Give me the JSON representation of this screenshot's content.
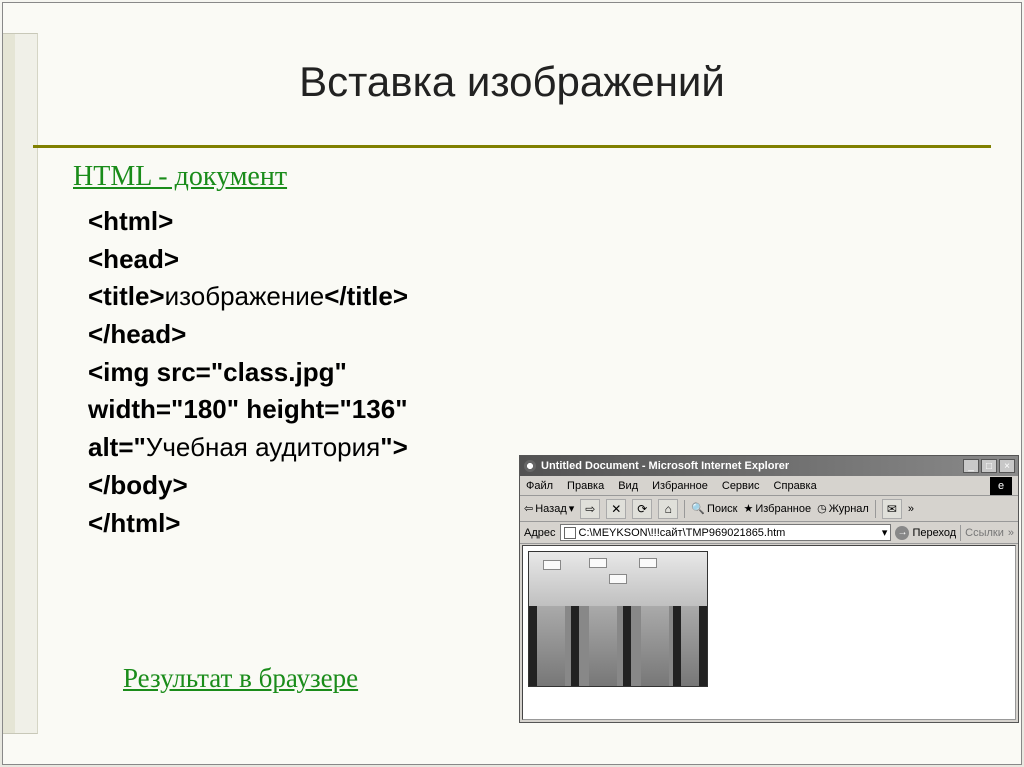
{
  "slide": {
    "title": "Вставка изображений",
    "section_label": "HTML - документ",
    "result_label": "Результат в браузере"
  },
  "code": {
    "l1": "<html>",
    "l2": "<head>",
    "l3a": "<title>",
    "l3b": "изображение",
    "l3c": "</title>",
    "l4": "</head>",
    "l5": "<img src=\"class.jpg\"",
    "l6": "width=\"180\" height=\"136\"",
    "l7a": "alt=\"",
    "l7b": "Учебная аудитория",
    "l7c": "\">",
    "l8": "</body>",
    "l9": "</html>"
  },
  "browser": {
    "title": "Untitled Document - Microsoft Internet Explorer",
    "menu": {
      "file": "Файл",
      "edit": "Правка",
      "view": "Вид",
      "favorites": "Избранное",
      "tools": "Сервис",
      "help": "Справка"
    },
    "toolbar": {
      "back": "Назад",
      "search": "Поиск",
      "favorites": "Избранное",
      "journal": "Журнал"
    },
    "address_label": "Адрес",
    "address_value": "C:\\MEYKSON\\!!!сайт\\TMP969021865.htm",
    "go_label": "Переход",
    "links_label": "Ссылки",
    "win": {
      "min": "_",
      "max": "□",
      "close": "×"
    }
  }
}
